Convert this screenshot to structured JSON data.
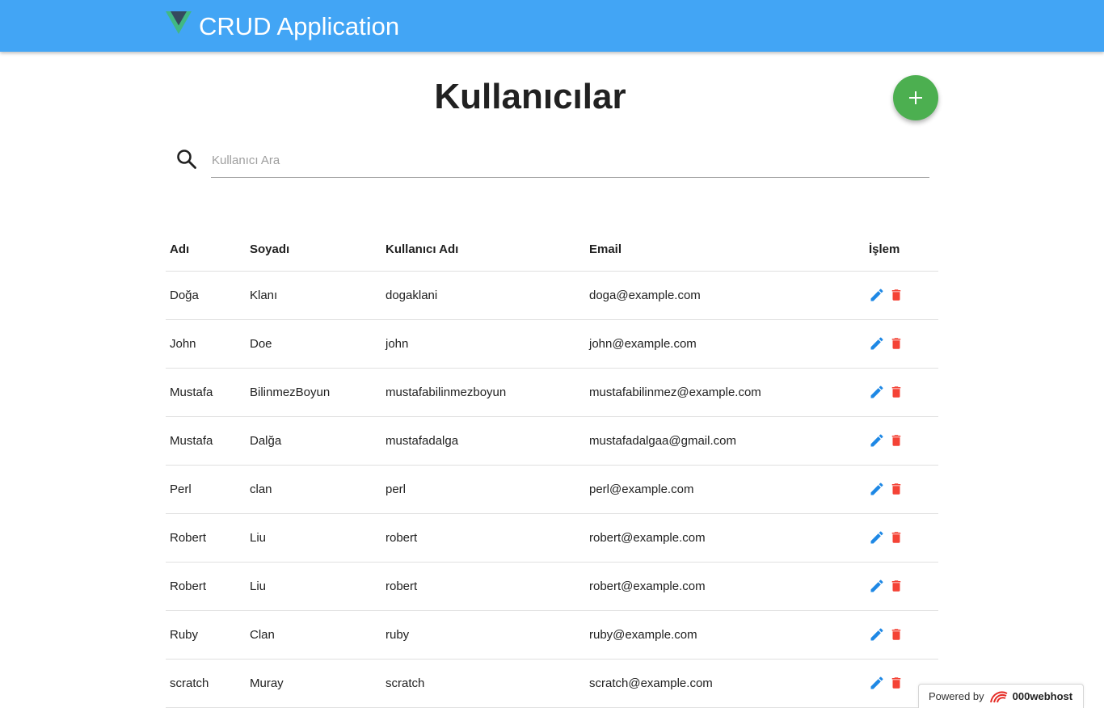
{
  "app_bar": {
    "title": "CRUD Application",
    "logo_icon": "vue-logo-icon",
    "color": "#42a5f5"
  },
  "page": {
    "title": "Kullanıcılar",
    "add_button_icon": "plus-icon",
    "add_button_color": "#4caf50"
  },
  "search": {
    "placeholder": "Kullanıcı Ara",
    "value": "",
    "icon": "search-icon"
  },
  "table": {
    "headers": {
      "first_name": "Adı",
      "last_name": "Soyadı",
      "username": "Kullanıcı Adı",
      "email": "Email",
      "actions": "İşlem"
    },
    "rows": [
      {
        "first_name": "Doğa",
        "last_name": "Klanı",
        "username": "dogaklani",
        "email": "doga@example.com"
      },
      {
        "first_name": "John",
        "last_name": "Doe",
        "username": "john",
        "email": "john@example.com"
      },
      {
        "first_name": "Mustafa",
        "last_name": "BilinmezBoyun",
        "username": "mustafabilinmezboyun",
        "email": "mustafabilinmez@example.com"
      },
      {
        "first_name": "Mustafa",
        "last_name": "Dalğa",
        "username": "mustafadalga",
        "email": "mustafadalgaa@gmail.com"
      },
      {
        "first_name": "Perl",
        "last_name": "clan",
        "username": "perl",
        "email": "perl@example.com"
      },
      {
        "first_name": "Robert",
        "last_name": "Liu",
        "username": "robert",
        "email": "robert@example.com"
      },
      {
        "first_name": "Robert",
        "last_name": "Liu",
        "username": "robert",
        "email": "robert@example.com"
      },
      {
        "first_name": "Ruby",
        "last_name": "Clan",
        "username": "ruby",
        "email": "ruby@example.com"
      },
      {
        "first_name": "scratch",
        "last_name": "Muray",
        "username": "scratch",
        "email": "scratch@example.com"
      }
    ],
    "edit_icon": "pencil-icon",
    "delete_icon": "trash-icon",
    "edit_color": "#1e88e5",
    "delete_color": "#f44336"
  },
  "badge": {
    "powered_by": "Powered by",
    "brand": "000webhost"
  }
}
